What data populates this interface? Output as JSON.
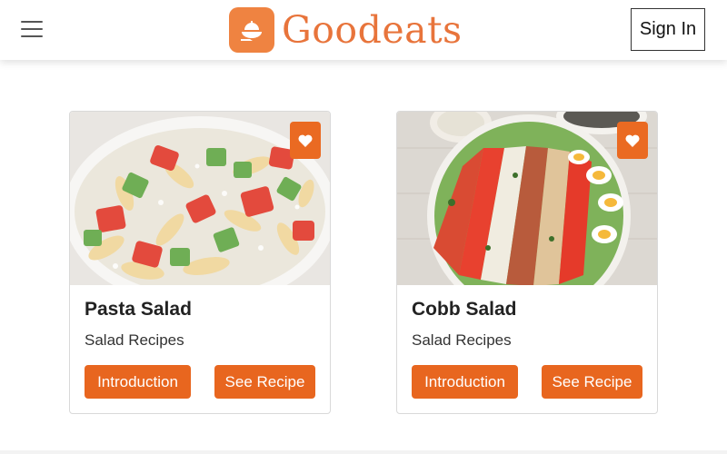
{
  "header": {
    "brand_name": "Goodeats",
    "sign_in_label": "Sign In",
    "menu_icon": "hamburger-menu-icon",
    "logo_icon": "serving-dish-icon"
  },
  "colors": {
    "brand": "#e8743b",
    "button": "#e8661f",
    "favorite": "#ea6a22"
  },
  "cards": [
    {
      "title": "Pasta Salad",
      "category": "Salad Recipes",
      "intro_label": "Introduction",
      "recipe_label": "See Recipe",
      "favorite_icon": "heart-icon"
    },
    {
      "title": "Cobb Salad",
      "category": "Salad Recipes",
      "intro_label": "Introduction",
      "recipe_label": "See Recipe",
      "favorite_icon": "heart-icon"
    }
  ]
}
